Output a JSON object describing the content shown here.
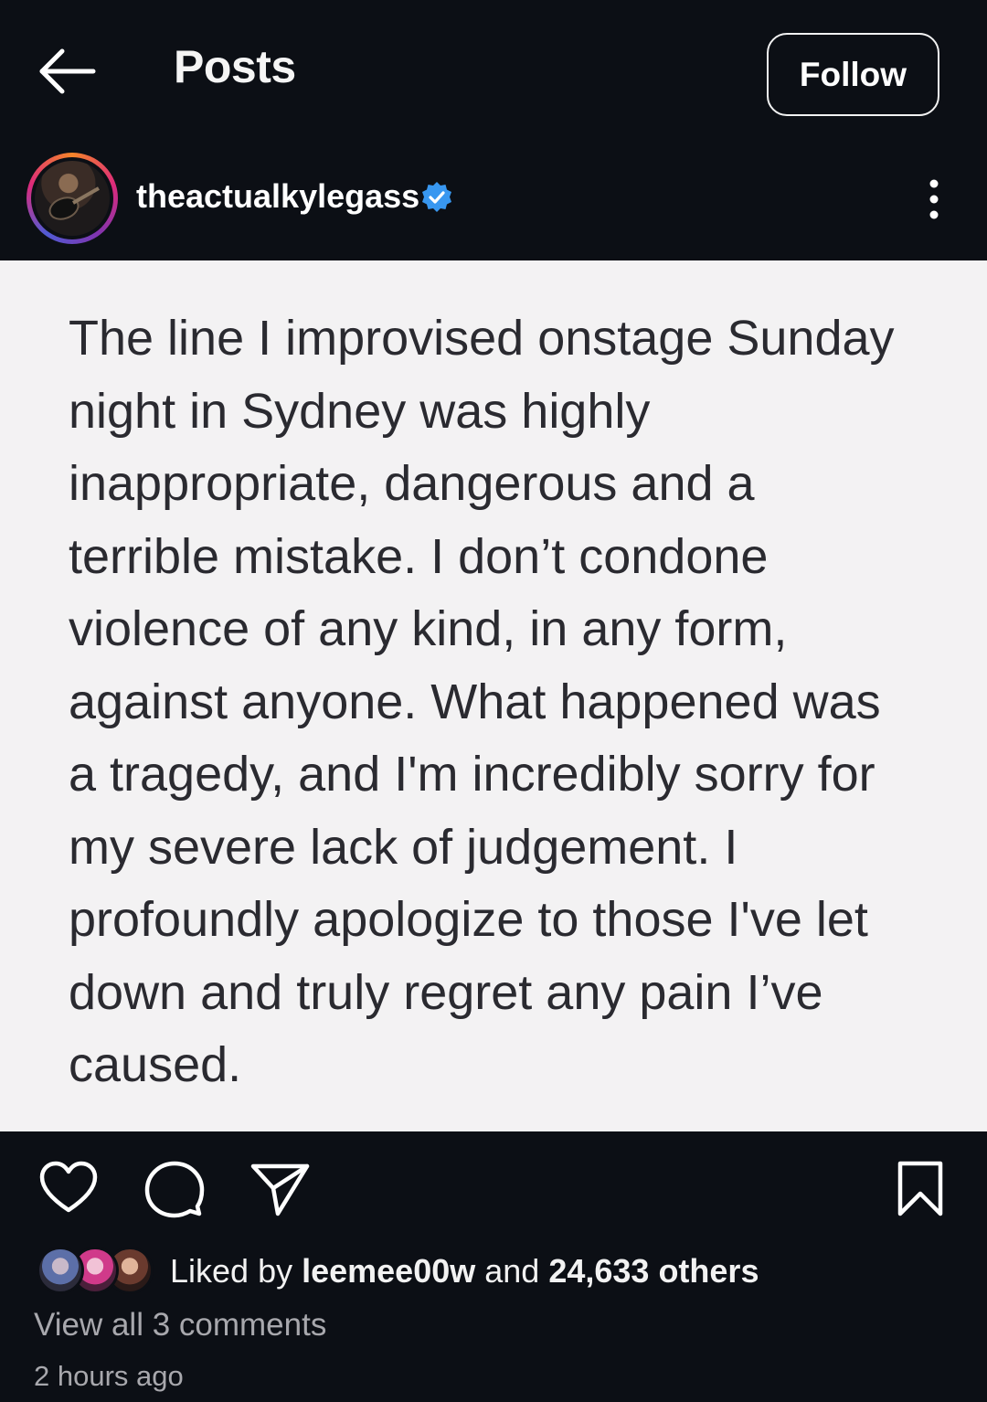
{
  "header": {
    "title": "Posts",
    "follow_label": "Follow"
  },
  "author": {
    "username": "theactualkylegass",
    "verified": true
  },
  "post": {
    "text": "The line I improvised onstage Sunday\nnight in Sydney was highly\ninappropriate, dangerous and a\nterrible mistake.  I don’t condone\nviolence of any kind, in any form,\nagainst anyone. What happened was\na tragedy, and I'm incredibly sorry for\nmy severe lack of judgement. I\nprofoundly apologize to those I've let\ndown and truly regret any pain I’ve\ncaused."
  },
  "likes": {
    "prefix": "Liked by ",
    "user": "leemee00w",
    "middle": " and ",
    "count": "24,633 others"
  },
  "comments": {
    "link": "View all 3 comments"
  },
  "meta": {
    "timestamp": "2 hours ago"
  },
  "colors": {
    "background": "#0c0f15",
    "post_bg": "#f3f2f3",
    "post_text": "#2a2a30",
    "verified": "#3897f0",
    "muted": "#a8a8ad"
  }
}
